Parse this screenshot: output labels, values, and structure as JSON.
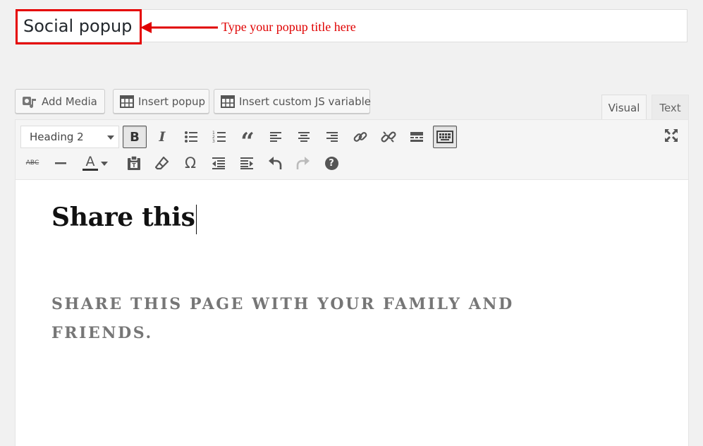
{
  "title": {
    "value": "Social popup",
    "annotation": "Type your popup title here"
  },
  "media_buttons": {
    "add_media": "Add Media",
    "insert_popup": "Insert popup",
    "insert_js": "Insert custom JS variable"
  },
  "tabs": {
    "visual": "Visual",
    "text": "Text",
    "active": "Visual"
  },
  "toolbar": {
    "format_select": "Heading 2",
    "row1": [
      "bold",
      "italic",
      "bulleted-list",
      "numbered-list",
      "blockquote",
      "align-left",
      "align-center",
      "align-right",
      "insert-link",
      "remove-link",
      "read-more",
      "toolbar-toggle",
      "fullscreen"
    ],
    "row2": [
      "strikethrough",
      "horizontal-line",
      "text-color",
      "paste-as-text",
      "clear-formatting",
      "special-character",
      "decrease-indent",
      "increase-indent",
      "undo",
      "redo",
      "keyboard-shortcuts"
    ],
    "strikethrough_glyph": "ABC",
    "text_color_glyph": "A",
    "special_char_glyph": "Ω",
    "help_glyph": "?",
    "bold_glyph": "B",
    "italic_glyph": "I",
    "quote_glyph": "“"
  },
  "content": {
    "heading": "Share this",
    "subtext": "SHARE THIS PAGE WITH YOUR FAMILY AND FRIENDS."
  },
  "colors": {
    "annotation_red": "#e00000",
    "subtext_gray": "#767676"
  }
}
